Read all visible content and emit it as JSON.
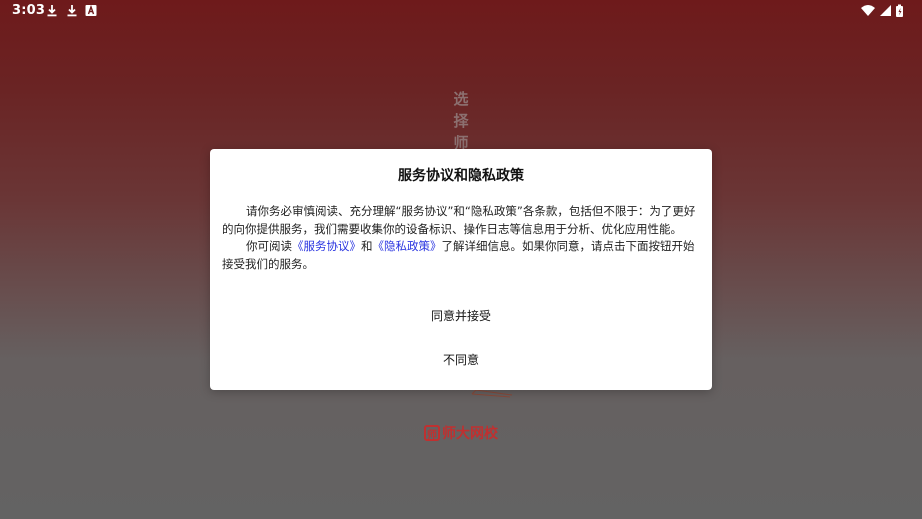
{
  "status_bar": {
    "time": "3:03",
    "left_icons": [
      "download-icon",
      "download-icon",
      "a-font-icon"
    ],
    "right_icons": [
      "wifi-icon",
      "signal-icon",
      "battery-icon"
    ]
  },
  "splash": {
    "vertical_text": [
      "选",
      "择",
      "师"
    ],
    "brand_mark": "师",
    "brand_name": "师大网校",
    "brand_color": "#c03030"
  },
  "dialog": {
    "title": "服务协议和隐私政策",
    "para1": "请你务必审慎阅读、充分理解“服务协议”和“隐私政策”各条款，包括但不限于：为了更好的向你提供服务，我们需要收集你的设备标识、操作日志等信息用于分析、优化应用性能。",
    "para2_prefix": "你可阅读",
    "service_link": "《服务协议》",
    "para2_and": "和",
    "privacy_link": "《隐私政策》",
    "para2_suffix": "了解详细信息。如果你同意，请点击下面按钮开始接受我们的服务。",
    "agree_button": "同意并接受",
    "disagree_button": "不同意",
    "link_color": "#2a35e0"
  }
}
